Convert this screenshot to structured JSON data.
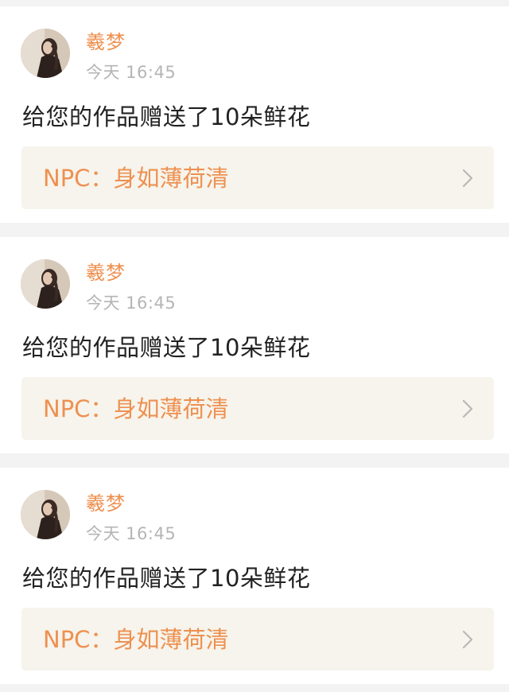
{
  "notifications": [
    {
      "user_name": "羲梦",
      "time": "今天 16:45",
      "message": "给您的作品赠送了10朵鲜花",
      "work_prefix": "NPC：",
      "work_title": "身如薄荷清",
      "avatar_icon": "user-avatar-photo",
      "chevron_icon": "chevron-right-icon"
    },
    {
      "user_name": "羲梦",
      "time": "今天 16:45",
      "message": "给您的作品赠送了10朵鲜花",
      "work_prefix": "NPC：",
      "work_title": "身如薄荷清",
      "avatar_icon": "user-avatar-photo",
      "chevron_icon": "chevron-right-icon"
    },
    {
      "user_name": "羲梦",
      "time": "今天 16:45",
      "message": "给您的作品赠送了10朵鲜花",
      "work_prefix": "NPC：",
      "work_title": "身如薄荷清",
      "avatar_icon": "user-avatar-photo",
      "chevron_icon": "chevron-right-icon"
    }
  ],
  "colors": {
    "accent": "#ee9050",
    "time_gray": "#b5b5b5",
    "message_text": "#222222",
    "link_box_bg": "#f6f4ec",
    "page_bg": "#f3f3f3",
    "card_bg": "#ffffff"
  }
}
